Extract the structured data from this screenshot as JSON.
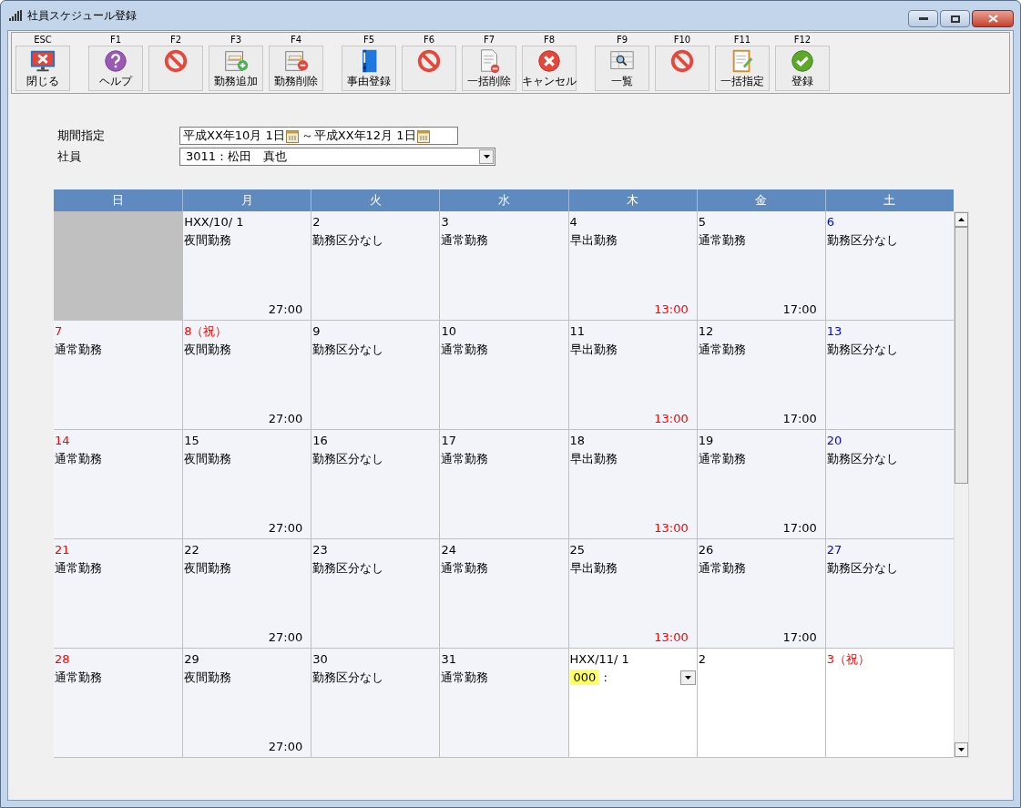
{
  "window": {
    "title": "社員スケジュール登録"
  },
  "toolbar": [
    [
      {
        "key": "ESC",
        "label": "閉じる",
        "kind": "close"
      }
    ],
    [
      {
        "key": "F1",
        "label": "ヘルプ",
        "kind": "help"
      },
      {
        "key": "F2",
        "kind": "prohibit"
      },
      {
        "key": "F3",
        "label": "勤務追加",
        "kind": "listadd"
      },
      {
        "key": "F4",
        "label": "勤務削除",
        "kind": "listremove"
      }
    ],
    [
      {
        "key": "F5",
        "label": "事由登録",
        "kind": "binder"
      },
      {
        "key": "F6",
        "kind": "prohibit"
      },
      {
        "key": "F7",
        "label": "一括削除",
        "kind": "docremove"
      },
      {
        "key": "F8",
        "label": "キャンセル",
        "kind": "cancel"
      }
    ],
    [
      {
        "key": "F9",
        "label": "一覧",
        "kind": "view"
      },
      {
        "key": "F10",
        "kind": "prohibit"
      },
      {
        "key": "F11",
        "label": "一括指定",
        "kind": "notepad"
      },
      {
        "key": "F12",
        "label": "登録",
        "kind": "check"
      }
    ]
  ],
  "form": {
    "period_label": "期間指定",
    "period_from": "平成XX年10月 1日",
    "period_separator": "～",
    "period_to": "平成XX年12月 1日",
    "employee_label": "社員",
    "employee": "3011：松田　真也"
  },
  "calendar": {
    "weekdays": [
      "日",
      "月",
      "火",
      "水",
      "木",
      "金",
      "土"
    ],
    "weeks": [
      [
        {
          "kind": "blank"
        },
        {
          "kind": "day",
          "date": "HXX/10/ 1",
          "color": "#000000",
          "shift": "夜間勤務",
          "time": "27:00",
          "time_alert": false
        },
        {
          "kind": "day",
          "date": "2",
          "color": "#000000",
          "shift": "勤務区分なし"
        },
        {
          "kind": "day",
          "date": "3",
          "color": "#000000",
          "shift": "通常勤務"
        },
        {
          "kind": "day",
          "date": "4",
          "color": "#000000",
          "shift": "早出勤務",
          "time": "13:00",
          "time_alert": true
        },
        {
          "kind": "day",
          "date": "5",
          "color": "#000000",
          "shift": "通常勤務",
          "time": "17:00",
          "time_alert": false
        },
        {
          "kind": "day",
          "date": "6",
          "color": "#0000ff",
          "shift": "勤務区分なし"
        }
      ],
      [
        {
          "kind": "day",
          "date": "7",
          "color": "#ff0000",
          "shift": "通常勤務"
        },
        {
          "kind": "day",
          "date": "8（祝）",
          "color": "#ff0000",
          "shift": "夜間勤務",
          "time": "27:00",
          "time_alert": false
        },
        {
          "kind": "day",
          "date": "9",
          "color": "#000000",
          "shift": "勤務区分なし"
        },
        {
          "kind": "day",
          "date": "10",
          "color": "#000000",
          "shift": "通常勤務"
        },
        {
          "kind": "day",
          "date": "11",
          "color": "#000000",
          "shift": "早出勤務",
          "time": "13:00",
          "time_alert": true
        },
        {
          "kind": "day",
          "date": "12",
          "color": "#000000",
          "shift": "通常勤務",
          "time": "17:00",
          "time_alert": false
        },
        {
          "kind": "day",
          "date": "13",
          "color": "#0000ff",
          "shift": "勤務区分なし"
        }
      ],
      [
        {
          "kind": "day",
          "date": "14",
          "color": "#ff0000",
          "shift": "通常勤務"
        },
        {
          "kind": "day",
          "date": "15",
          "color": "#000000",
          "shift": "夜間勤務",
          "time": "27:00",
          "time_alert": false
        },
        {
          "kind": "day",
          "date": "16",
          "color": "#000000",
          "shift": "勤務区分なし"
        },
        {
          "kind": "day",
          "date": "17",
          "color": "#000000",
          "shift": "通常勤務"
        },
        {
          "kind": "day",
          "date": "18",
          "color": "#000000",
          "shift": "早出勤務",
          "time": "13:00",
          "time_alert": true
        },
        {
          "kind": "day",
          "date": "19",
          "color": "#000000",
          "shift": "通常勤務",
          "time": "17:00",
          "time_alert": false
        },
        {
          "kind": "day",
          "date": "20",
          "color": "#0000ff",
          "shift": "勤務区分なし"
        }
      ],
      [
        {
          "kind": "day",
          "date": "21",
          "color": "#ff0000",
          "shift": "通常勤務"
        },
        {
          "kind": "day",
          "date": "22",
          "color": "#000000",
          "shift": "夜間勤務",
          "time": "27:00",
          "time_alert": false
        },
        {
          "kind": "day",
          "date": "23",
          "color": "#000000",
          "shift": "勤務区分なし"
        },
        {
          "kind": "day",
          "date": "24",
          "color": "#000000",
          "shift": "通常勤務"
        },
        {
          "kind": "day",
          "date": "25",
          "color": "#000000",
          "shift": "早出勤務",
          "time": "13:00",
          "time_alert": true
        },
        {
          "kind": "day",
          "date": "26",
          "color": "#000000",
          "shift": "通常勤務",
          "time": "17:00",
          "time_alert": false
        },
        {
          "kind": "day",
          "date": "27",
          "color": "#0000ff",
          "shift": "勤務区分なし"
        }
      ],
      [
        {
          "kind": "day",
          "date": "28",
          "color": "#ff0000",
          "shift": "通常勤務"
        },
        {
          "kind": "day",
          "date": "29",
          "color": "#000000",
          "shift": "夜間勤務",
          "time": "27:00",
          "time_alert": false
        },
        {
          "kind": "day",
          "date": "30",
          "color": "#000000",
          "shift": "勤務区分なし"
        },
        {
          "kind": "day",
          "date": "31",
          "color": "#000000",
          "shift": "通常勤務"
        },
        {
          "kind": "edit",
          "date": "HXX/11/ 1",
          "color": "#000000",
          "code": "000",
          "separator": ":"
        },
        {
          "kind": "future",
          "date": "2",
          "color": "#000000"
        },
        {
          "kind": "future",
          "date": "3（祝）",
          "color": "#ff0000"
        }
      ]
    ]
  }
}
